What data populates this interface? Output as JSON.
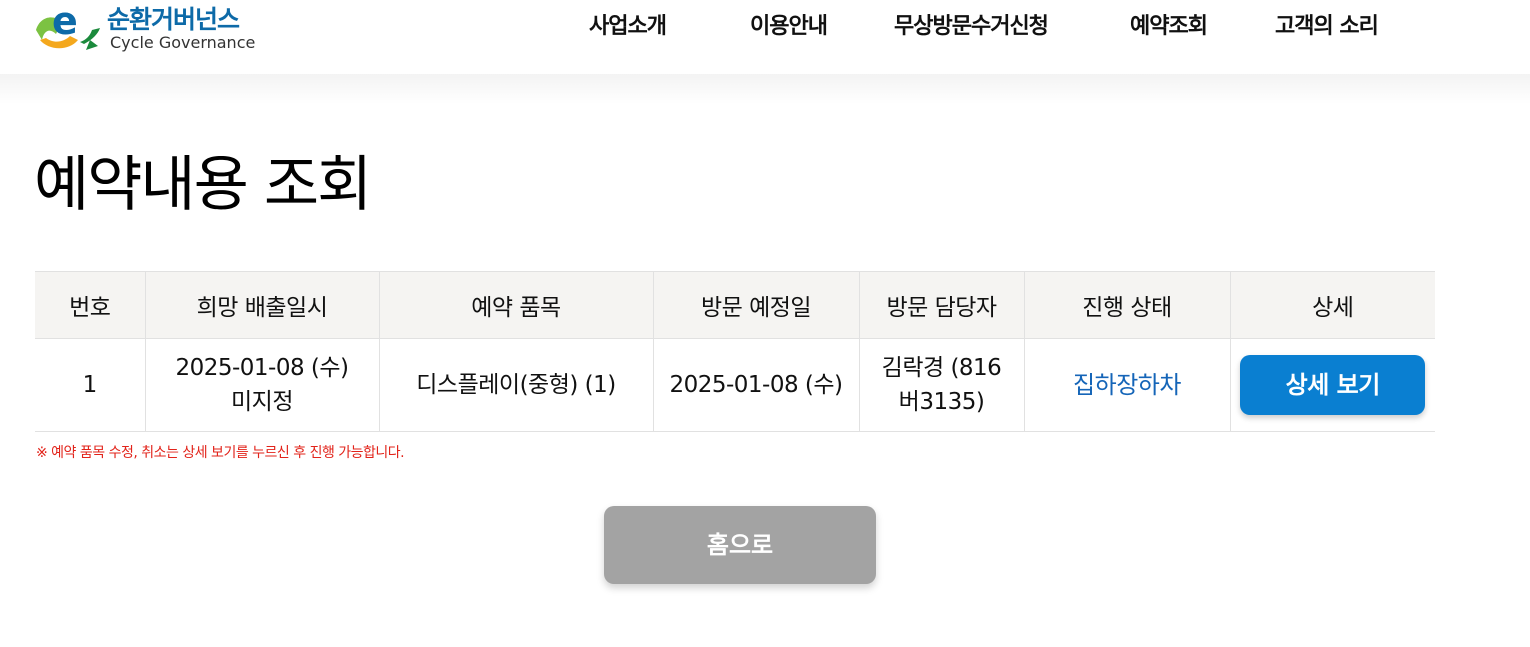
{
  "header": {
    "logo": {
      "title_ko": "순환거버넌스",
      "title_en": "Cycle Governance"
    },
    "nav": [
      {
        "label": "사업소개"
      },
      {
        "label": "이용안내"
      },
      {
        "label": "무상방문수거신청"
      },
      {
        "label": "예약조회"
      },
      {
        "label": "고객의 소리"
      }
    ]
  },
  "main": {
    "title": "예약내용 조회",
    "table": {
      "columns": [
        "번호",
        "희망 배출일시",
        "예약 품목",
        "방문 예정일",
        "방문 담당자",
        "진행 상태",
        "상세"
      ],
      "rows": [
        {
          "number": "1",
          "desired_date": "2025-01-08 (수)",
          "desired_time": "미지정",
          "item": "디스플레이(중형) (1)",
          "visit_date": "2025-01-08 (수)",
          "manager_line1": "김락경 (816",
          "manager_line2": "버3135)",
          "status": "집하장하차",
          "detail_label": "상세 보기"
        }
      ]
    },
    "notice": "※ 예약 품목 수정, 취소는 상세 보기를 누르신 후 진행 가능합니다.",
    "home_button": "홈으로"
  },
  "colors": {
    "primary_button": "#0a7fd1",
    "status_text": "#1565b8",
    "notice_text": "#e2231a",
    "home_button": "#a3a3a3",
    "table_header_bg": "#f5f4f2"
  }
}
